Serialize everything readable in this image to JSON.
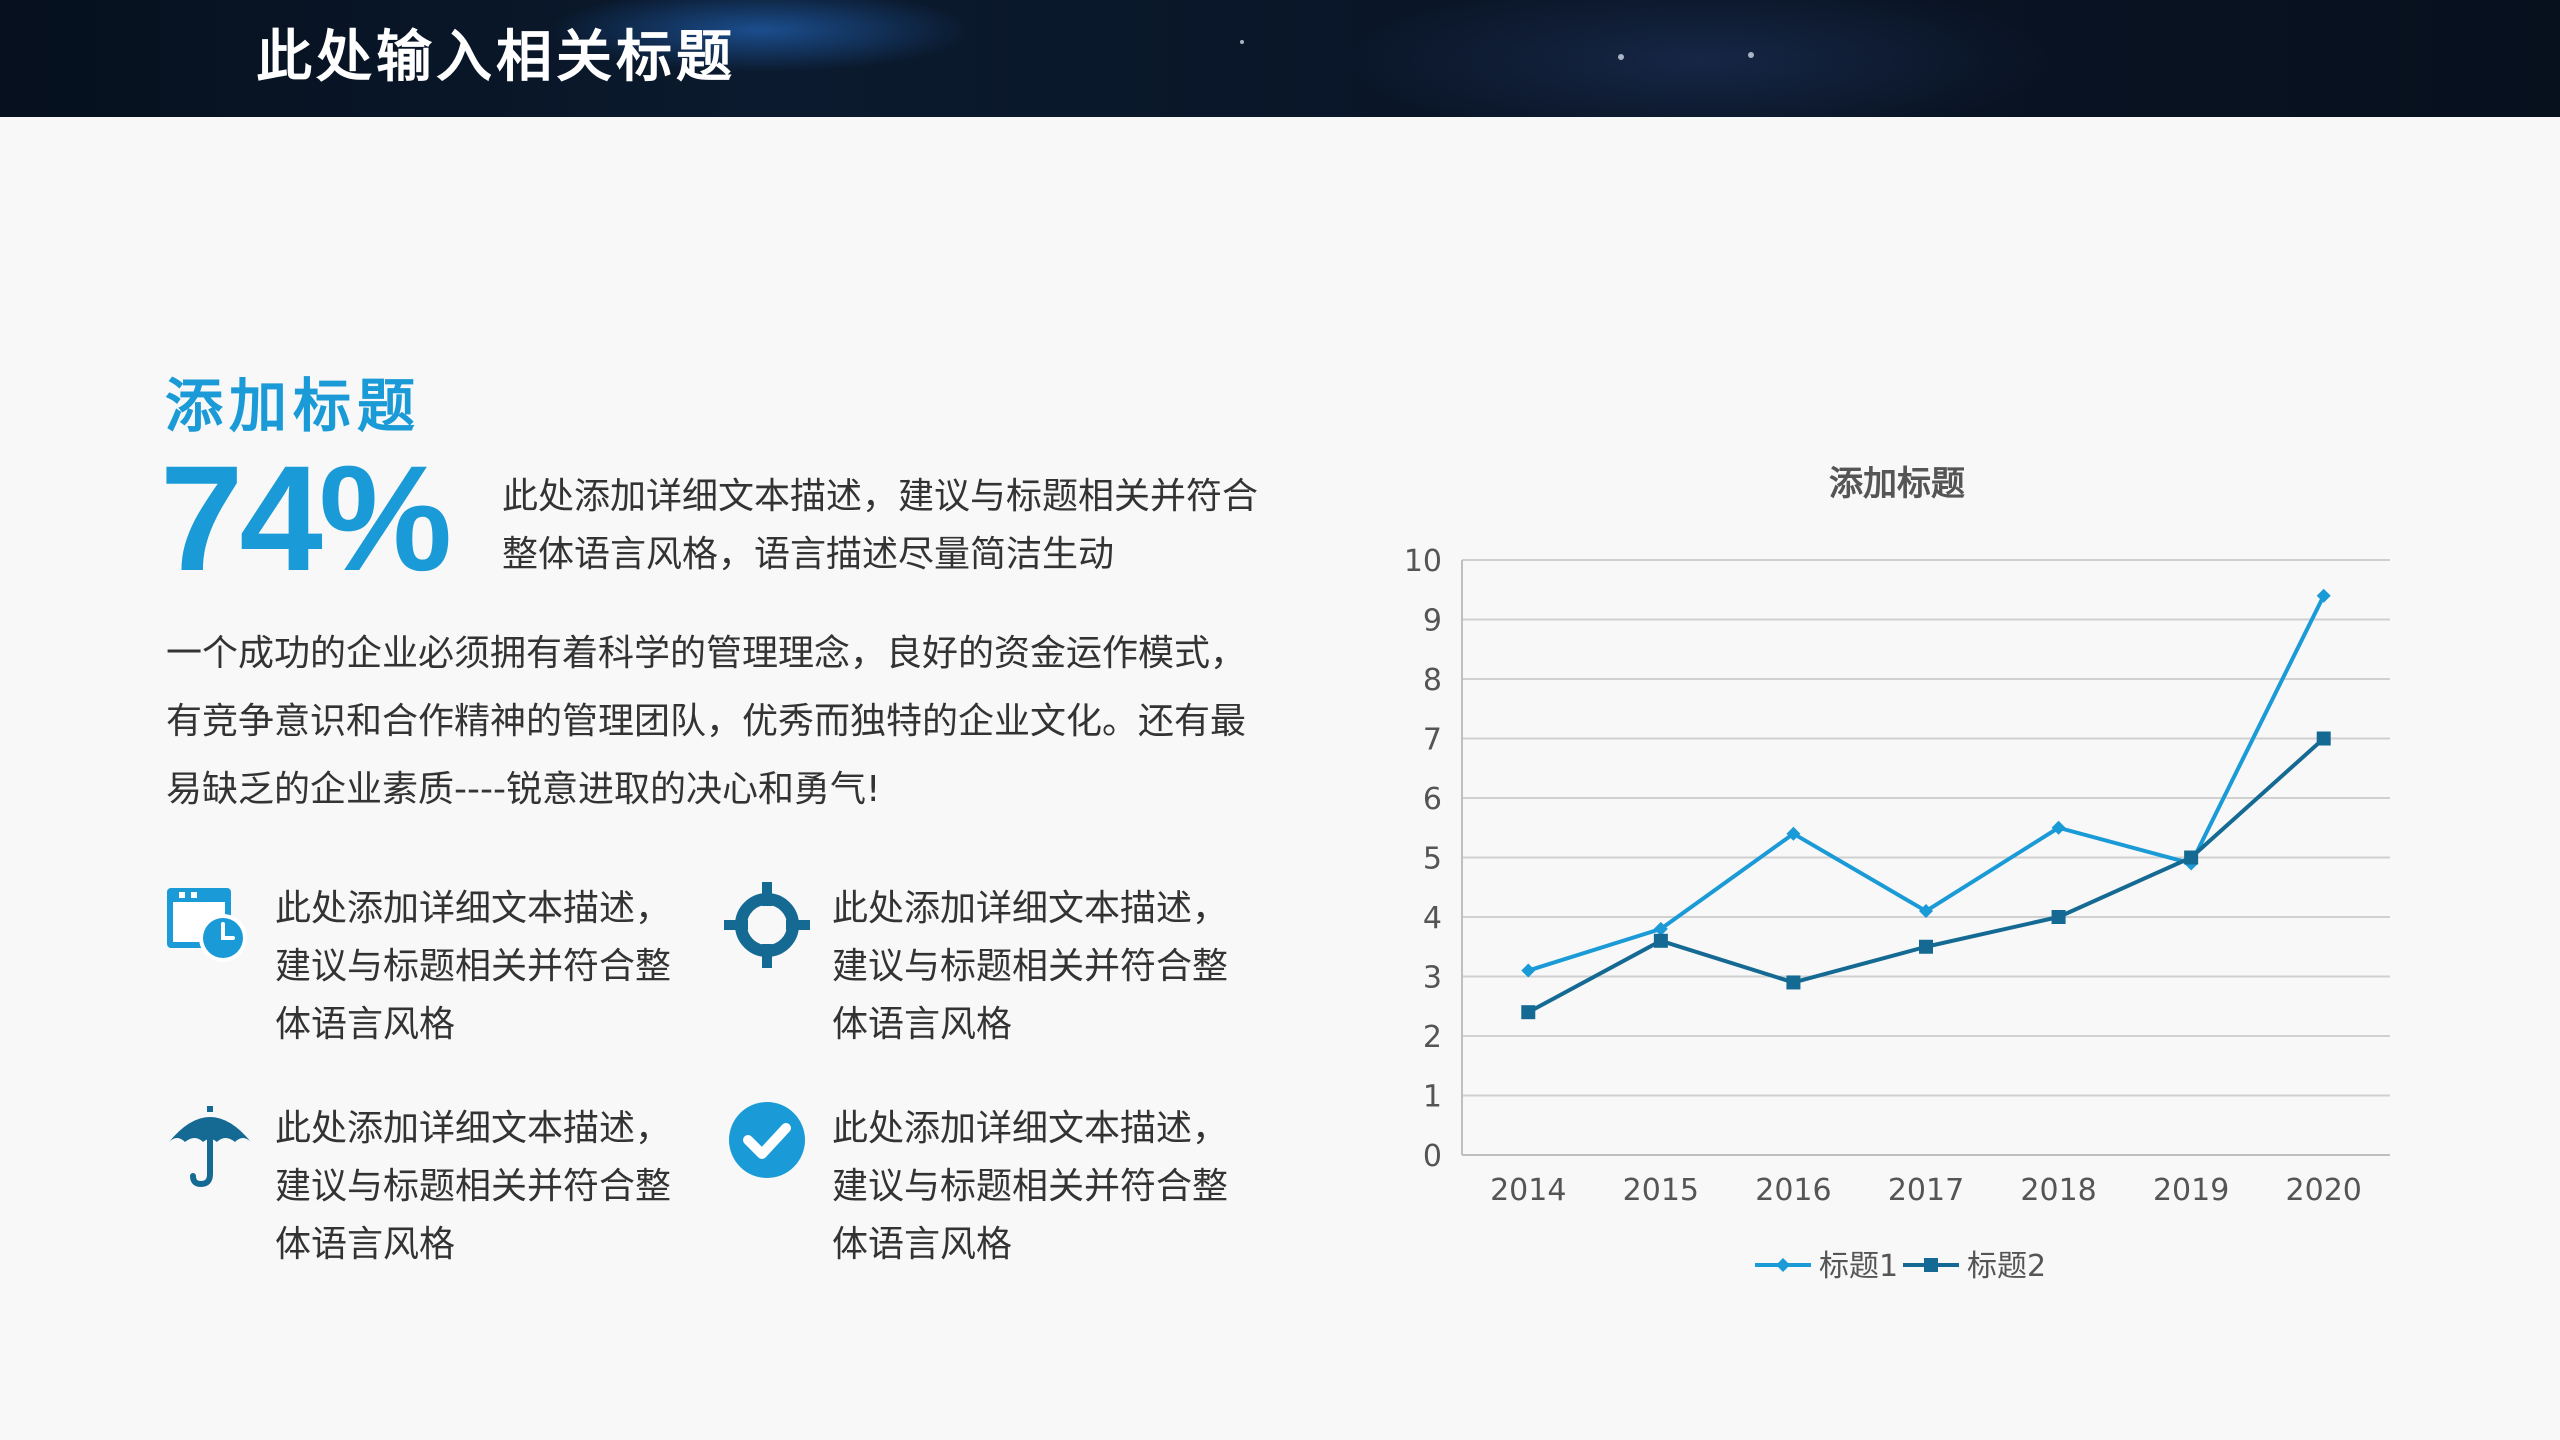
{
  "header": {
    "title": "此处输入相关标题"
  },
  "section": {
    "title": "添加标题"
  },
  "stat": {
    "percent": "74%",
    "description": "此处添加详细文本描述，建议与标题相关并符合整体语言风格，语言描述尽量简洁生动"
  },
  "body": {
    "paragraph": "一个成功的企业必须拥有着科学的管理理念，良好的资金运作模式，有竞争意识和合作精神的管理团队，优秀而独特的企业文化。还有最易缺乏的企业素质----锐意进取的决心和勇气!"
  },
  "features": [
    {
      "icon": "calendar-clock-icon",
      "text": "此处添加详细文本描述，建议与标题相关并符合整体语言风格"
    },
    {
      "icon": "crosshair-icon",
      "text": "此处添加详细文本描述，建议与标题相关并符合整体语言风格"
    },
    {
      "icon": "umbrella-icon",
      "text": "此处添加详细文本描述，建议与标题相关并符合整体语言风格"
    },
    {
      "icon": "checkmark-circle-icon",
      "text": "此处添加详细文本描述，建议与标题相关并符合整体语言风格"
    }
  ],
  "colors": {
    "accent": "#1a9ad6",
    "dark_accent": "#156a94",
    "text": "#333333"
  },
  "chart_data": {
    "type": "line",
    "title": "添加标题",
    "categories": [
      "2014",
      "2015",
      "2016",
      "2017",
      "2018",
      "2019",
      "2020"
    ],
    "series": [
      {
        "name": "标题1",
        "values": [
          3.1,
          3.8,
          5.4,
          4.1,
          5.5,
          4.9,
          9.4
        ],
        "color": "#1a9ad6",
        "marker": "diamond"
      },
      {
        "name": "标题2",
        "values": [
          2.4,
          3.6,
          2.9,
          3.5,
          4.0,
          5.0,
          7.0
        ],
        "color": "#156a94",
        "marker": "square"
      }
    ],
    "ylim": [
      0,
      10
    ],
    "yticks": [
      0,
      1,
      2,
      3,
      4,
      5,
      6,
      7,
      8,
      9,
      10
    ],
    "grid": true,
    "legend": "bottom"
  }
}
